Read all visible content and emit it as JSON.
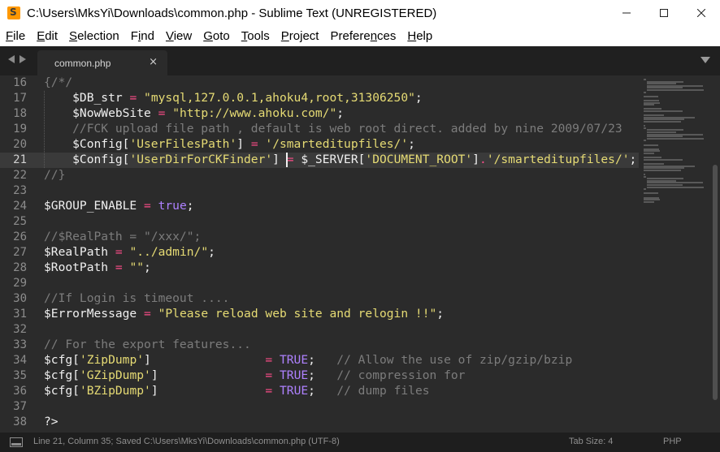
{
  "window": {
    "title": "C:\\Users\\MksYi\\Downloads\\common.php - Sublime Text (UNREGISTERED)",
    "minimize_glyph": "—",
    "maximize_glyph": "☐",
    "close_glyph": "✕"
  },
  "menu": [
    {
      "label": "File",
      "u": "F",
      "rest": "ile"
    },
    {
      "label": "Edit",
      "u": "E",
      "rest": "dit"
    },
    {
      "label": "Selection",
      "u": "S",
      "rest": "election"
    },
    {
      "label": "Find",
      "pre": "F",
      "u": "i",
      "rest": "nd"
    },
    {
      "label": "View",
      "u": "V",
      "rest": "iew"
    },
    {
      "label": "Goto",
      "u": "G",
      "rest": "oto"
    },
    {
      "label": "Tools",
      "u": "T",
      "rest": "ools"
    },
    {
      "label": "Project",
      "u": "P",
      "rest": "roject"
    },
    {
      "label": "Preferences",
      "pre": "Prefere",
      "u": "n",
      "rest": "ces"
    },
    {
      "label": "Help",
      "u": "H",
      "rest": "elp"
    }
  ],
  "tabs": [
    {
      "label": "common.php",
      "close_glyph": "×"
    }
  ],
  "editor": {
    "active_line": 21,
    "cursor_column": 35,
    "lines": [
      {
        "n": "16",
        "tokens": [
          {
            "t": "{/*/",
            "c": "c"
          }
        ]
      },
      {
        "n": "17",
        "tokens": [
          {
            "t": "    $DB_str ",
            "c": "v"
          },
          {
            "t": "=",
            "c": "o"
          },
          {
            "t": " ",
            "c": "p"
          },
          {
            "t": "\"mysql,127.0.0.1,ahoku4,root,31306250\"",
            "c": "s"
          },
          {
            "t": ";",
            "c": "p"
          }
        ]
      },
      {
        "n": "18",
        "tokens": [
          {
            "t": "    $NowWebSite ",
            "c": "v"
          },
          {
            "t": "=",
            "c": "o"
          },
          {
            "t": " ",
            "c": "p"
          },
          {
            "t": "\"http://www.ahoku.com/\"",
            "c": "s"
          },
          {
            "t": ";",
            "c": "p"
          }
        ]
      },
      {
        "n": "19",
        "tokens": [
          {
            "t": "    //FCK upload file path , default is web root direct. added by nine 2009/07/23",
            "c": "c"
          }
        ]
      },
      {
        "n": "20",
        "tokens": [
          {
            "t": "    $Config[",
            "c": "v"
          },
          {
            "t": "'UserFilesPath'",
            "c": "s"
          },
          {
            "t": "] ",
            "c": "v"
          },
          {
            "t": "=",
            "c": "o"
          },
          {
            "t": " ",
            "c": "p"
          },
          {
            "t": "'/smarteditupfiles/'",
            "c": "s"
          },
          {
            "t": ";",
            "c": "p"
          }
        ]
      },
      {
        "n": "21",
        "tokens": [
          {
            "t": "    $Config[",
            "c": "v"
          },
          {
            "t": "'UserDirForCKFinder'",
            "c": "s"
          },
          {
            "t": "] ",
            "c": "v"
          },
          {
            "t": "=",
            "c": "o"
          },
          {
            "t": " $_SERVER[",
            "c": "v"
          },
          {
            "t": "'DOCUMENT_ROOT'",
            "c": "s"
          },
          {
            "t": "]",
            "c": "v"
          },
          {
            "t": ".",
            "c": "o"
          },
          {
            "t": "'/smarteditupfiles/'",
            "c": "s"
          },
          {
            "t": ";",
            "c": "p"
          }
        ]
      },
      {
        "n": "22",
        "tokens": [
          {
            "t": "//}",
            "c": "c"
          }
        ]
      },
      {
        "n": "23",
        "tokens": []
      },
      {
        "n": "24",
        "tokens": [
          {
            "t": "$GROUP_ENABLE ",
            "c": "v"
          },
          {
            "t": "=",
            "c": "o"
          },
          {
            "t": " ",
            "c": "p"
          },
          {
            "t": "true",
            "c": "k"
          },
          {
            "t": ";",
            "c": "p"
          }
        ]
      },
      {
        "n": "25",
        "tokens": []
      },
      {
        "n": "26",
        "tokens": [
          {
            "t": "//$RealPath = \"/xxx/\";",
            "c": "c"
          }
        ]
      },
      {
        "n": "27",
        "tokens": [
          {
            "t": "$RealPath ",
            "c": "v"
          },
          {
            "t": "=",
            "c": "o"
          },
          {
            "t": " ",
            "c": "p"
          },
          {
            "t": "\"../admin/\"",
            "c": "s"
          },
          {
            "t": ";",
            "c": "p"
          }
        ]
      },
      {
        "n": "28",
        "tokens": [
          {
            "t": "$RootPath ",
            "c": "v"
          },
          {
            "t": "=",
            "c": "o"
          },
          {
            "t": " ",
            "c": "p"
          },
          {
            "t": "\"\"",
            "c": "s"
          },
          {
            "t": ";",
            "c": "p"
          }
        ]
      },
      {
        "n": "29",
        "tokens": []
      },
      {
        "n": "30",
        "tokens": [
          {
            "t": "//If Login is timeout ....",
            "c": "c"
          }
        ]
      },
      {
        "n": "31",
        "tokens": [
          {
            "t": "$ErrorMessage ",
            "c": "v"
          },
          {
            "t": "=",
            "c": "o"
          },
          {
            "t": " ",
            "c": "p"
          },
          {
            "t": "\"Please reload web site and relogin !!\"",
            "c": "s"
          },
          {
            "t": ";",
            "c": "p"
          }
        ]
      },
      {
        "n": "32",
        "tokens": []
      },
      {
        "n": "33",
        "tokens": [
          {
            "t": "// For the export features...",
            "c": "c"
          }
        ]
      },
      {
        "n": "34",
        "tokens": [
          {
            "t": "$cfg[",
            "c": "v"
          },
          {
            "t": "'ZipDump'",
            "c": "s"
          },
          {
            "t": "]                ",
            "c": "v"
          },
          {
            "t": "=",
            "c": "o"
          },
          {
            "t": " ",
            "c": "p"
          },
          {
            "t": "TRUE",
            "c": "k"
          },
          {
            "t": ";   ",
            "c": "p"
          },
          {
            "t": "// Allow the use of zip/gzip/bzip",
            "c": "c"
          }
        ]
      },
      {
        "n": "35",
        "tokens": [
          {
            "t": "$cfg[",
            "c": "v"
          },
          {
            "t": "'GZipDump'",
            "c": "s"
          },
          {
            "t": "]               ",
            "c": "v"
          },
          {
            "t": "=",
            "c": "o"
          },
          {
            "t": " ",
            "c": "p"
          },
          {
            "t": "TRUE",
            "c": "k"
          },
          {
            "t": ";   ",
            "c": "p"
          },
          {
            "t": "// compression for",
            "c": "c"
          }
        ]
      },
      {
        "n": "36",
        "tokens": [
          {
            "t": "$cfg[",
            "c": "v"
          },
          {
            "t": "'BZipDump'",
            "c": "s"
          },
          {
            "t": "]               ",
            "c": "v"
          },
          {
            "t": "=",
            "c": "o"
          },
          {
            "t": " ",
            "c": "p"
          },
          {
            "t": "TRUE",
            "c": "k"
          },
          {
            "t": ";   ",
            "c": "p"
          },
          {
            "t": "// dump files",
            "c": "c"
          }
        ]
      },
      {
        "n": "37",
        "tokens": []
      },
      {
        "n": "38",
        "tokens": [
          {
            "t": "?>",
            "c": "p"
          }
        ]
      }
    ]
  },
  "status": {
    "left": "Line 21, Column 35; Saved C:\\Users\\MksYi\\Downloads\\common.php (UTF-8)",
    "tab_size": "Tab Size: 4",
    "syntax": "PHP"
  },
  "colors": {
    "editor_bg": "#2b2b2b",
    "comment": "#7c7c7c",
    "string": "#e6db74",
    "operator": "#ff4d8a",
    "keyword": "#ae81ff",
    "icon_accent": "#ff9800"
  },
  "icons": {
    "app": "sublime-text-icon",
    "nav_back": "triangle-left-icon",
    "nav_forward": "triangle-right-icon",
    "tab_menu": "triangle-down-icon",
    "status_panel": "panel-toggle-icon"
  }
}
